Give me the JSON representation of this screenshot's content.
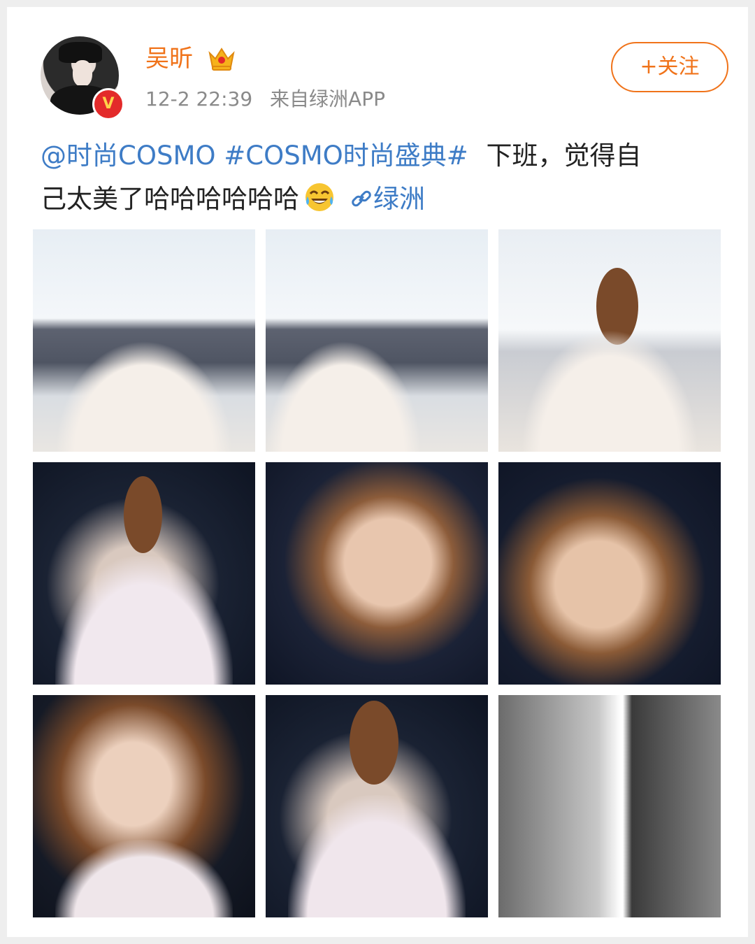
{
  "post": {
    "author": {
      "name": "吴昕",
      "verified_badge": "V",
      "crown_icon": "crown-icon"
    },
    "timestamp": "12-2 22:39",
    "source": "来自绿洲APP",
    "follow_label": "+关注",
    "text": {
      "mention": "@时尚COSMO",
      "hashtag": "#COSMO时尚盛典#",
      "body_line1": "下班，觉得自",
      "body_line2": "己太美了哈哈哈哈哈哈",
      "emoji": "laugh-tears-emoji",
      "link_icon": "link-icon",
      "link_label": "绿洲"
    },
    "images": [
      {
        "label": "photo-1"
      },
      {
        "label": "photo-2"
      },
      {
        "label": "photo-3"
      },
      {
        "label": "photo-4"
      },
      {
        "label": "photo-5"
      },
      {
        "label": "photo-6"
      },
      {
        "label": "photo-7"
      },
      {
        "label": "photo-8"
      },
      {
        "label": "photo-9"
      }
    ]
  },
  "colors": {
    "accent_orange": "#f0731a",
    "link_blue": "#3e7cc6",
    "meta_gray": "#8a8a8a",
    "text_dark": "#222222"
  }
}
